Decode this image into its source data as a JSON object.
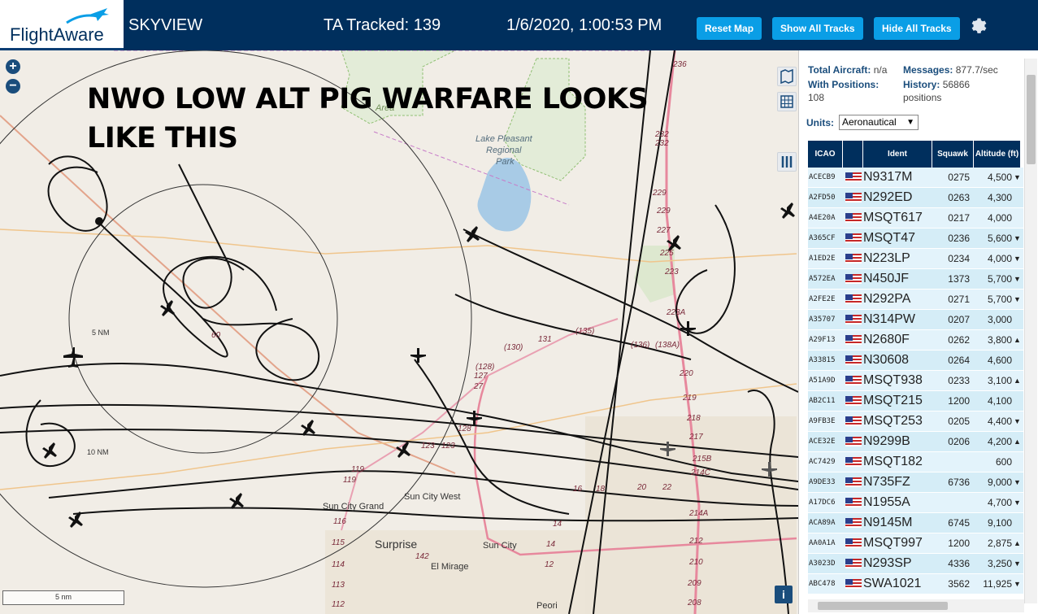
{
  "header": {
    "logo_text": "FlightAware",
    "app_name": "SKYVIEW",
    "tracked": "TA Tracked: 139",
    "datetime": "1/6/2020, 1:00:53 PM",
    "buttons": {
      "reset": "Reset Map",
      "show_all": "Show All Tracks",
      "hide_all": "Hide All Tracks"
    },
    "settings_icon": "gear-icon"
  },
  "map": {
    "zoom_in": "+",
    "zoom_out": "−",
    "overlay_text": "NWO LOW ALT PIG WARFARE LOOKS LIKE THIS",
    "scale": "5 nm",
    "info_label": "i",
    "labels": {
      "lake": "Lake Pleasant",
      "lake2": "Regional",
      "lake3": "Park",
      "surprise": "Surprise",
      "sun_city": "Sun City",
      "sun_city_grand": "Sun City Grand",
      "sun_city_west": "Sun City West",
      "el_mirage": "El Mirage",
      "area": "Area",
      "ring10": "10 NM",
      "ring5": "5 NM",
      "peoria": "Peori"
    },
    "route_numbers": [
      "236",
      "232",
      "232",
      "229",
      "229",
      "227",
      "225",
      "223",
      "223A",
      "(136)",
      "(138A)",
      "220",
      "219",
      "218",
      "217",
      "215B",
      "214C",
      "214A",
      "212",
      "210",
      "209",
      "208",
      "(135)",
      "131",
      "(130)",
      "(128)",
      "127",
      "27",
      "128",
      "123",
      "123",
      "119",
      "119",
      "116",
      "115",
      "114",
      "113",
      "112",
      "142",
      "14",
      "14",
      "12",
      "16",
      "18",
      "20",
      "22",
      "60"
    ]
  },
  "panel": {
    "total_aircraft_label": "Total Aircraft:",
    "total_aircraft_value": "n/a",
    "messages_label": "Messages:",
    "messages_value": "877.7/sec",
    "with_positions_label": "With Positions:",
    "with_positions_value": "108",
    "history_label": "History:",
    "history_value": "56866 positions",
    "units_label": "Units:",
    "units_value": "Aeronautical",
    "columns": [
      "ICAO",
      "",
      "Ident",
      "Squawk",
      "Altitude (ft)"
    ],
    "rows": [
      {
        "icao": "ACECB9",
        "ident": "N9317M",
        "squawk": "0275",
        "alt": "4,500",
        "trend": "▼"
      },
      {
        "icao": "A2FD50",
        "ident": "N292ED",
        "squawk": "0263",
        "alt": "4,300",
        "trend": ""
      },
      {
        "icao": "A4E20A",
        "ident": "MSQT617",
        "squawk": "0217",
        "alt": "4,000",
        "trend": ""
      },
      {
        "icao": "A365CF",
        "ident": "MSQT47",
        "squawk": "0236",
        "alt": "5,600",
        "trend": "▼"
      },
      {
        "icao": "A1ED2E",
        "ident": "N223LP",
        "squawk": "0234",
        "alt": "4,000",
        "trend": "▼"
      },
      {
        "icao": "A572EA",
        "ident": "N450JF",
        "squawk": "1373",
        "alt": "5,700",
        "trend": "▼"
      },
      {
        "icao": "A2FE2E",
        "ident": "N292PA",
        "squawk": "0271",
        "alt": "5,700",
        "trend": "▼"
      },
      {
        "icao": "A35707",
        "ident": "N314PW",
        "squawk": "0207",
        "alt": "3,000",
        "trend": ""
      },
      {
        "icao": "A29F13",
        "ident": "N2680F",
        "squawk": "0262",
        "alt": "3,800",
        "trend": "▲"
      },
      {
        "icao": "A33815",
        "ident": "N30608",
        "squawk": "0264",
        "alt": "4,600",
        "trend": ""
      },
      {
        "icao": "A51A9D",
        "ident": "MSQT938",
        "squawk": "0233",
        "alt": "3,100",
        "trend": "▲"
      },
      {
        "icao": "AB2C11",
        "ident": "MSQT215",
        "squawk": "1200",
        "alt": "4,100",
        "trend": ""
      },
      {
        "icao": "A9FB3E",
        "ident": "MSQT253",
        "squawk": "0205",
        "alt": "4,400",
        "trend": "▼"
      },
      {
        "icao": "ACE32E",
        "ident": "N9299B",
        "squawk": "0206",
        "alt": "4,200",
        "trend": "▲"
      },
      {
        "icao": "AC7429",
        "ident": "MSQT182",
        "squawk": "",
        "alt": "600",
        "trend": ""
      },
      {
        "icao": "A9DE33",
        "ident": "N735FZ",
        "squawk": "6736",
        "alt": "9,000",
        "trend": "▼"
      },
      {
        "icao": "A17DC6",
        "ident": "N1955A",
        "squawk": "",
        "alt": "4,700",
        "trend": "▼"
      },
      {
        "icao": "ACA89A",
        "ident": "N9145M",
        "squawk": "6745",
        "alt": "9,100",
        "trend": ""
      },
      {
        "icao": "AA0A1A",
        "ident": "MSQT997",
        "squawk": "1200",
        "alt": "2,875",
        "trend": "▲"
      },
      {
        "icao": "A3023D",
        "ident": "N293SP",
        "squawk": "4336",
        "alt": "3,250",
        "trend": "▼"
      },
      {
        "icao": "ABC478",
        "ident": "SWA1021",
        "squawk": "3562",
        "alt": "11,925",
        "trend": "▼"
      }
    ]
  }
}
